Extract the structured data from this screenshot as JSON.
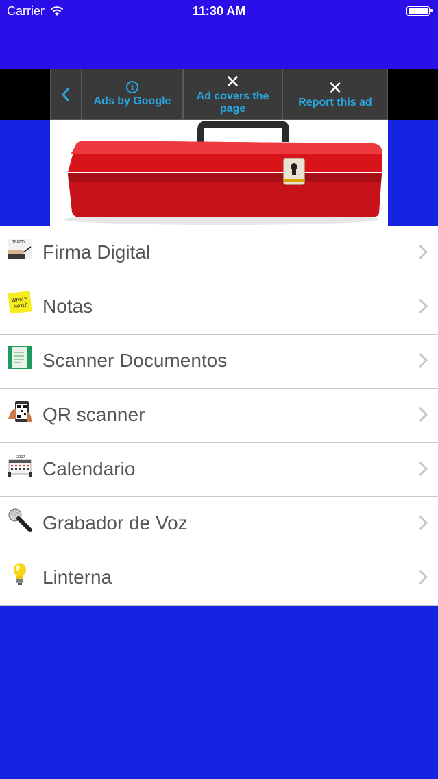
{
  "status_bar": {
    "carrier": "Carrier",
    "time": "11:30 AM"
  },
  "ad_toolbar": {
    "ads_by_google": "Ads by Google",
    "ad_covers_line1": "Ad covers the",
    "ad_covers_line2": "page",
    "report": "Report this ad"
  },
  "menu": {
    "items": [
      {
        "label": "Firma Digital",
        "icon": "signature-icon"
      },
      {
        "label": "Notas",
        "icon": "sticky-note-icon"
      },
      {
        "label": "Scanner Documentos",
        "icon": "document-icon"
      },
      {
        "label": "QR scanner",
        "icon": "qr-code-icon"
      },
      {
        "label": "Calendario",
        "icon": "calendar-icon"
      },
      {
        "label": "Grabador de Voz",
        "icon": "microphone-icon"
      },
      {
        "label": "Linterna",
        "icon": "lightbulb-icon"
      }
    ]
  },
  "icon_text": {
    "treaty": "TREATY",
    "whats_next_1": "What's",
    "whats_next_2": "Next?",
    "calendar_year": "2017"
  },
  "colors": {
    "top_bar": "#2a0fe8",
    "background": "#1524e0",
    "ad_link": "#2aa5df"
  }
}
